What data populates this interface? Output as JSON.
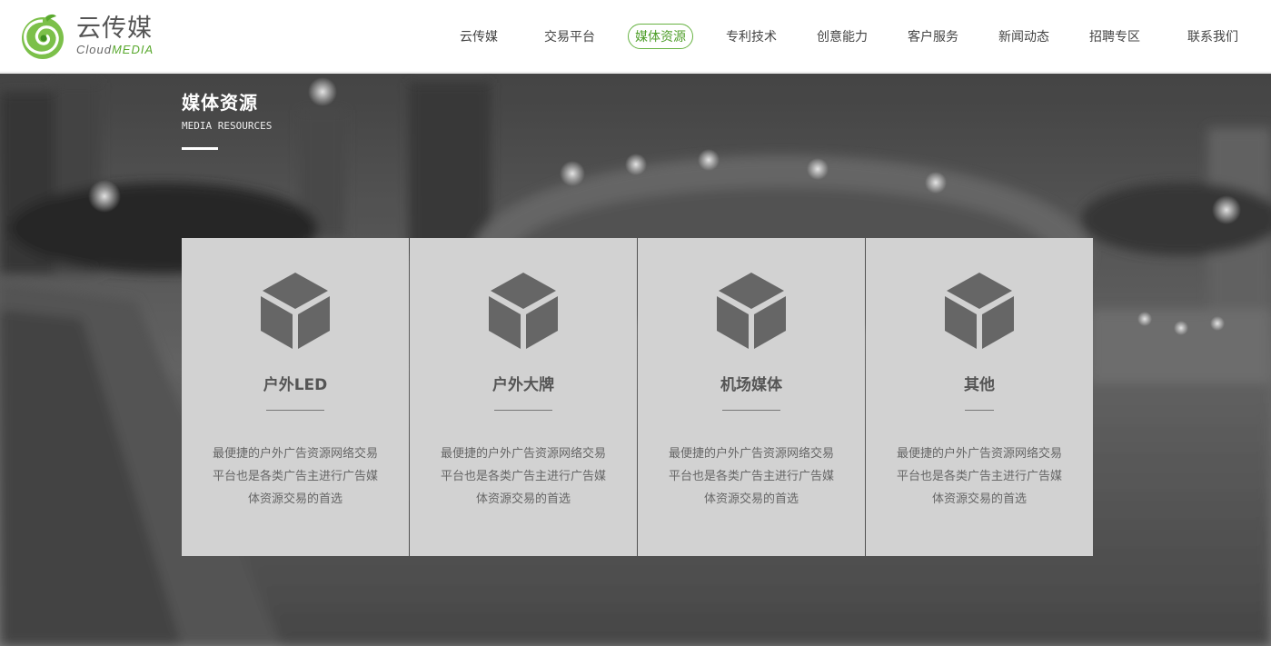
{
  "header": {
    "logo_cn": "云传媒",
    "logo_en_1": "Cloud",
    "logo_en_2": "MEDIA",
    "nav": [
      {
        "label": "云传媒"
      },
      {
        "label": "交易平台"
      },
      {
        "label": "媒体资源",
        "active": true
      },
      {
        "label": "专利技术"
      },
      {
        "label": "创意能力"
      },
      {
        "label": "客户服务"
      },
      {
        "label": "新闻动态"
      },
      {
        "label": "招聘专区"
      },
      {
        "label": "联系我们"
      }
    ]
  },
  "section": {
    "title_cn": "媒体资源",
    "title_en": "MEDIA RESOURCES"
  },
  "cards": [
    {
      "title": "户外LED",
      "desc": "最便捷的户外广告资源网络交易平台也是各类广告主进行广告媒体资源交易的首选",
      "icon": "cube-icon"
    },
    {
      "title": "户外大牌",
      "desc": "最便捷的户外广告资源网络交易平台也是各类广告主进行广告媒体资源交易的首选",
      "icon": "cube-icon"
    },
    {
      "title": "机场媒体",
      "desc": "最便捷的户外广告资源网络交易平台也是各类广告主进行广告媒体资源交易的首选",
      "icon": "cube-icon"
    },
    {
      "title": "其他",
      "desc": "最便捷的户外广告资源网络交易平台也是各类广告主进行广告媒体资源交易的首选",
      "icon": "cube-icon"
    }
  ],
  "colors": {
    "accent": "#67b343",
    "card_bg": "#d2d2d2",
    "icon": "#666666"
  }
}
